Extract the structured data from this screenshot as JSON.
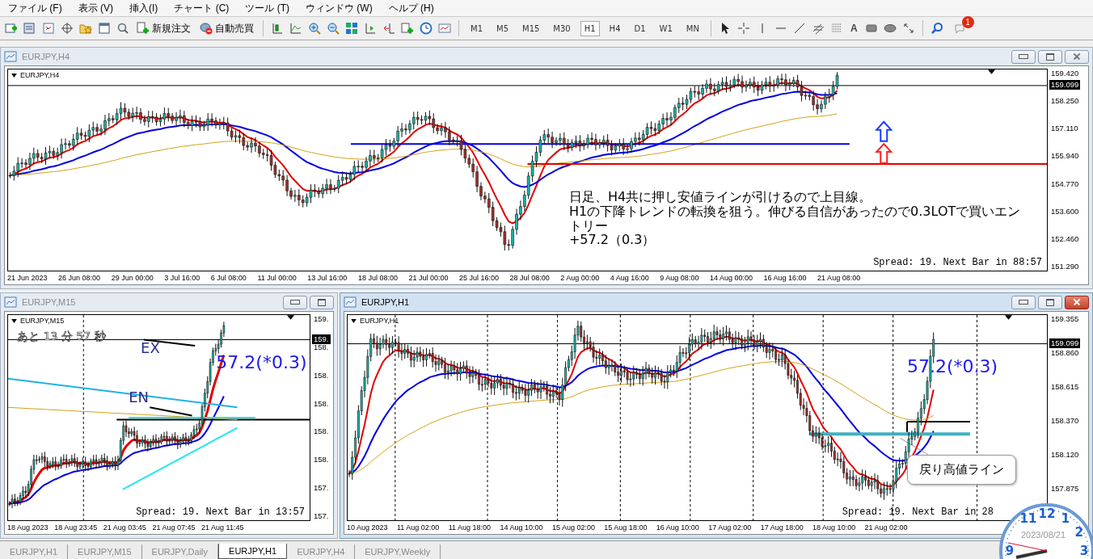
{
  "menu": [
    "ファイル (F)",
    "表示 (V)",
    "挿入(I)",
    "チャート (C)",
    "ツール (T)",
    "ウィンドウ (W)",
    "ヘルプ (H)"
  ],
  "toolbar": {
    "order_button": "新規注文",
    "autotrade_button": "自動売買",
    "text_tool": "A",
    "notification_badge": "1",
    "timeframes": [
      {
        "label": "M1",
        "selected": false
      },
      {
        "label": "M5",
        "selected": false
      },
      {
        "label": "M15",
        "selected": false
      },
      {
        "label": "M30",
        "selected": false
      },
      {
        "label": "H1",
        "selected": true
      },
      {
        "label": "H4",
        "selected": false
      },
      {
        "label": "D1",
        "selected": false
      },
      {
        "label": "W1",
        "selected": false
      },
      {
        "label": "MN",
        "selected": false
      }
    ]
  },
  "windows": [
    {
      "title": "EURJPY,H4",
      "active": false,
      "close_button_visible": true,
      "chart_label": "EURJPY,H4",
      "current_price": "159.099",
      "price_labels": [
        "159.420",
        "158.250",
        "157.110",
        "155.940",
        "154.770",
        "153.600",
        "152.460",
        "151.290"
      ],
      "time_labels": [
        "21 Jun 2023",
        "26 Jun 08:00",
        "29 Jun 00:00",
        "3 Jul 16:00",
        "6 Jul 08:00",
        "11 Jul 00:00",
        "13 Jul 16:00",
        "18 Jul 08:00",
        "21 Jul 00:00",
        "25 Jul 16:00",
        "28 Jul 08:00",
        "2 Aug 00:00",
        "4 Aug 16:00",
        "9 Aug 08:00",
        "14 Aug 00:00",
        "16 Aug 16:00",
        "21 Aug 08:00"
      ],
      "status": "Spread: 19. Next Bar in 88:57",
      "annotations": [
        {
          "kind": "comment",
          "text": "日足、H4共に押し安値ラインが引けるので上目線。\nH1の下降トレンドの転換を狙う。伸びる自信があったので0.3LOTで買いエントリー\n+57.2（0.3）"
        }
      ]
    },
    {
      "title": "EURJPY,M15",
      "active": false,
      "close_button_visible": false,
      "chart_label": "EURJPY,M15",
      "current_price": "159.",
      "price_labels": [
        "159.",
        "158.",
        "158.",
        "158.",
        "158.",
        "158.",
        "157.",
        "157."
      ],
      "time_labels": [
        "18 Aug 2023",
        "18 Aug 23:45",
        "21 Aug 03:45",
        "21 Aug 07:45",
        "21 Aug 11:45"
      ],
      "status": "Spread: 19. Next Bar in 13:57",
      "annotations": [
        {
          "kind": "timer",
          "text": "あと 13 分 57 秒"
        },
        {
          "kind": "marker",
          "text": "EX"
        },
        {
          "kind": "profit",
          "text": "57.2(*0.3)"
        },
        {
          "kind": "marker",
          "text": "EN"
        }
      ]
    },
    {
      "title": "EURJPY,H1",
      "active": true,
      "close_button_visible": true,
      "chart_label": "EURJPY,H1",
      "current_price": "159.099",
      "price_labels": [
        "159.355",
        "158.860",
        "158.615",
        "158.370",
        "158.120",
        "157.875"
      ],
      "time_labels": [
        "10 Aug 2023",
        "11 Aug 02:00",
        "11 Aug 18:00",
        "14 Aug 10:00",
        "15 Aug 02:00",
        "15 Aug 18:00",
        "16 Aug 10:00",
        "17 Aug 02:00",
        "17 Aug 18:00",
        "18 Aug 10:00",
        "21 Aug 02:00"
      ],
      "status": "Spread: 19. Next Bar in 28",
      "annotations": [
        {
          "kind": "profit",
          "text": "57.2(*0.3)"
        },
        {
          "kind": "callout",
          "text": "戻り高値ライン"
        }
      ]
    }
  ],
  "tabs": [
    {
      "label": "EURJPY,H1",
      "selected": false
    },
    {
      "label": "EURJPY,M15",
      "selected": false
    },
    {
      "label": "EURJPY,Daily",
      "selected": false
    },
    {
      "label": "EURJPY,H1",
      "selected": true
    },
    {
      "label": "EURJPY,H4",
      "selected": false
    },
    {
      "label": "EURJPY,Weekly",
      "selected": false
    }
  ],
  "clock": {
    "numbers": [
      "11",
      "12",
      "1",
      "2",
      "3",
      "9"
    ],
    "date": "2023/08/21"
  }
}
